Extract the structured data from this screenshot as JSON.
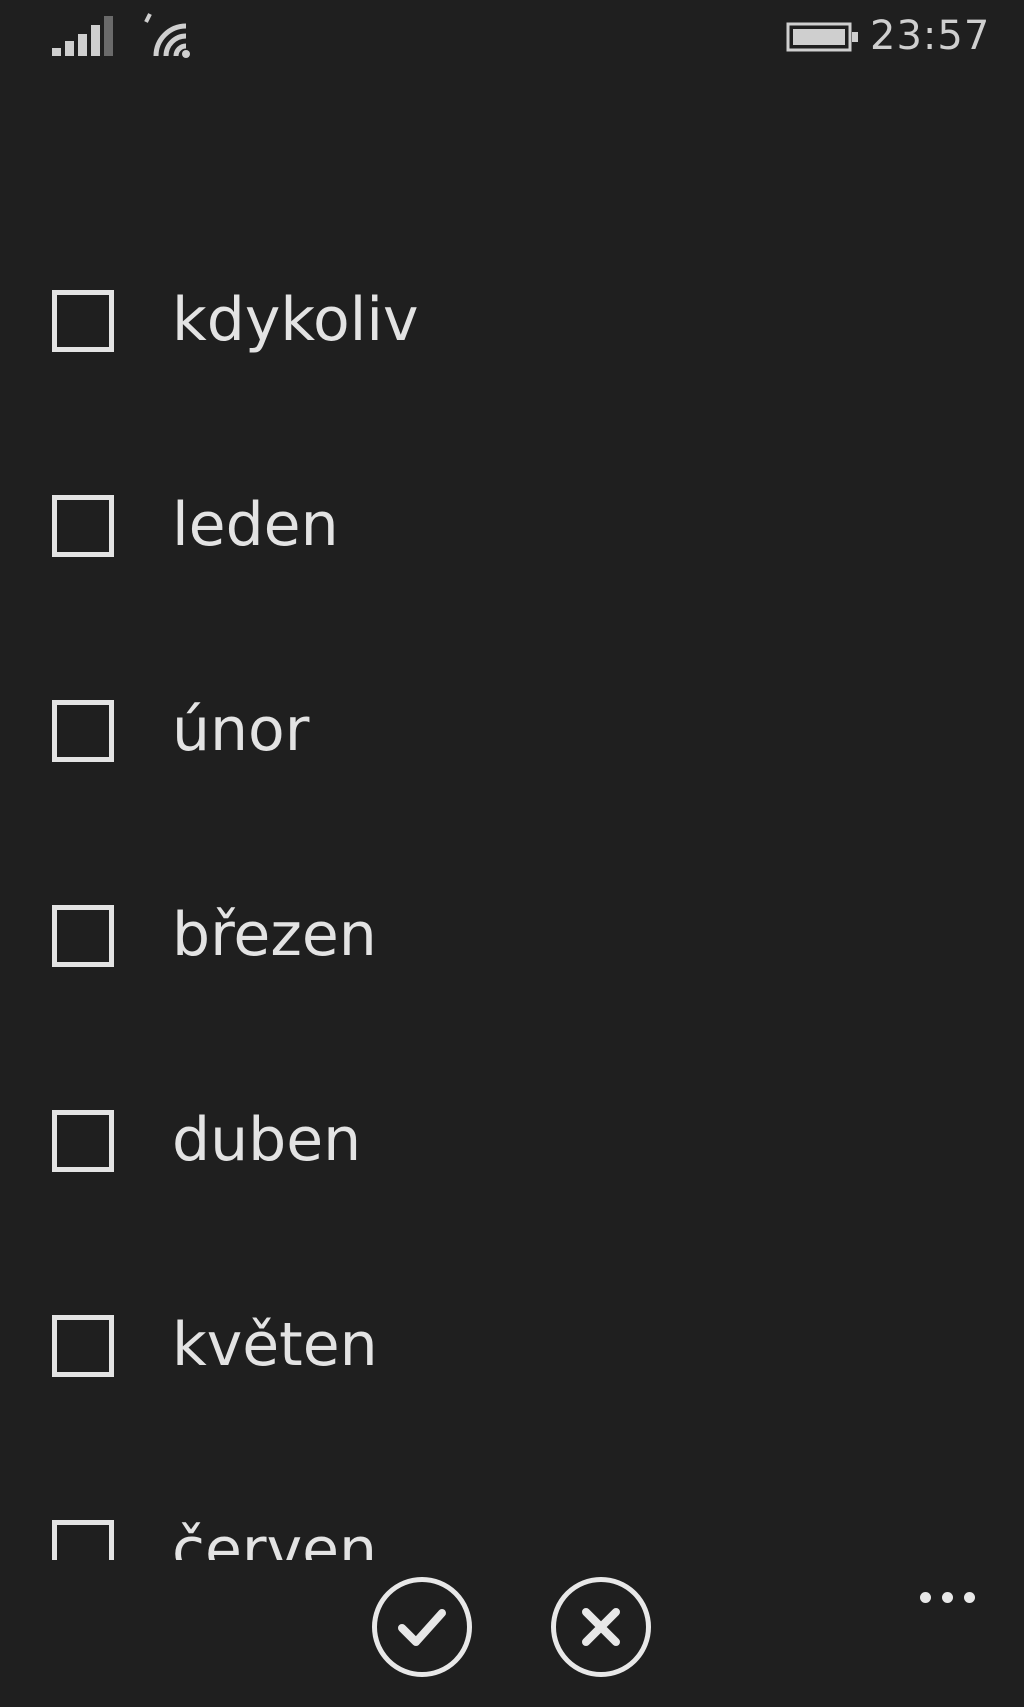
{
  "status_bar": {
    "time": "23:57",
    "icons": [
      "signal-strength-icon",
      "wifi-icon",
      "battery-icon"
    ]
  },
  "list": {
    "items": [
      {
        "label": "kdykoliv",
        "checked": false
      },
      {
        "label": "leden",
        "checked": false
      },
      {
        "label": "únor",
        "checked": false
      },
      {
        "label": "březen",
        "checked": false
      },
      {
        "label": "duben",
        "checked": false
      },
      {
        "label": "květen",
        "checked": false
      },
      {
        "label": "červen",
        "checked": false
      }
    ]
  },
  "app_bar": {
    "buttons": [
      "check-icon",
      "close-icon",
      "more-icon"
    ]
  },
  "colors": {
    "background": "#1f1f1f",
    "foreground": "#e3e3e3"
  }
}
